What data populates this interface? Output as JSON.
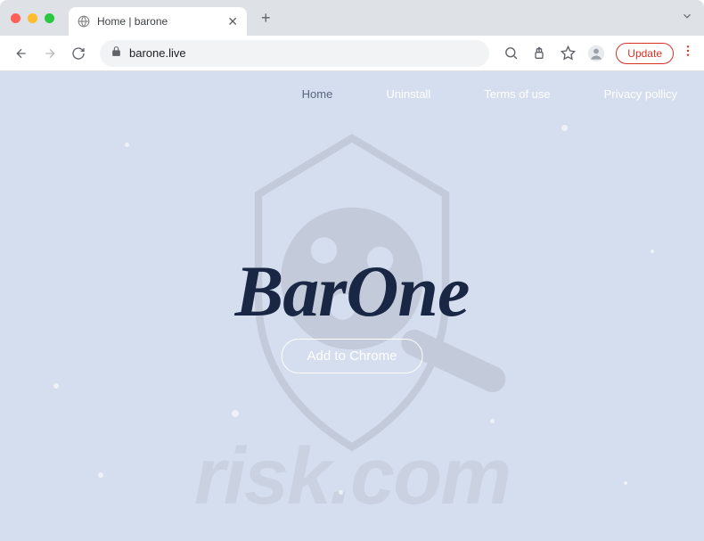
{
  "browser": {
    "tab_title": "Home | barone",
    "url": "barone.live",
    "update_label": "Update"
  },
  "nav": {
    "items": [
      {
        "label": "Home",
        "active": true
      },
      {
        "label": "Uninstall",
        "active": false
      },
      {
        "label": "Terms of use",
        "active": false
      },
      {
        "label": "Privacy pollicy",
        "active": false
      }
    ]
  },
  "hero": {
    "brand": "BarOne",
    "cta_label": "Add to Chrome"
  },
  "watermark": {
    "text": "risk.com"
  }
}
